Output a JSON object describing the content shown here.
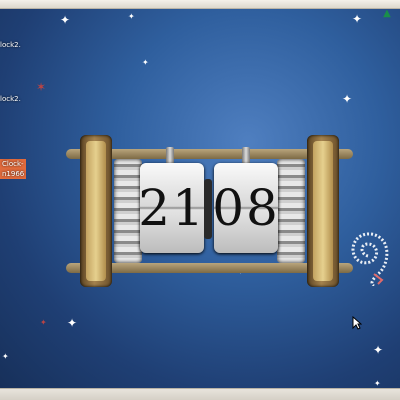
{
  "desktop": {
    "labels": [
      {
        "text": "lock2.",
        "selected": false
      },
      {
        "text": "lock2.",
        "selected": false
      },
      {
        "text": "Clock-",
        "selected": true
      },
      {
        "text": "n1966",
        "selected": true
      }
    ]
  },
  "clock": {
    "hours": "21",
    "minutes": "08"
  },
  "tray": {
    "icon": "tray-status-icon"
  },
  "colors": {
    "desktop_bg": "#2f5f9e",
    "selection": "#e06a3c"
  }
}
